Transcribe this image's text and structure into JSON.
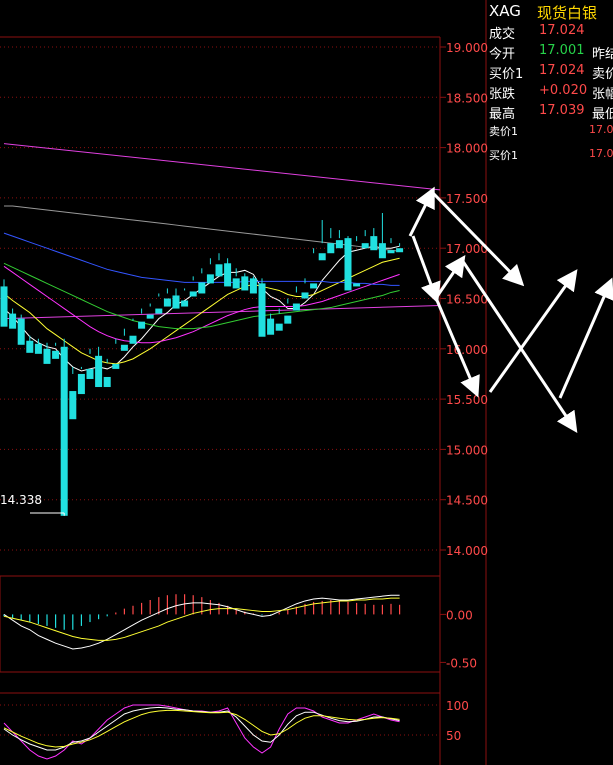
{
  "quote": {
    "symbol": "XAG",
    "name": "现货白银",
    "rows": [
      {
        "label": "成交",
        "value": "17.024",
        "color": "red",
        "label2": ""
      },
      {
        "label": "今开",
        "value": "17.001",
        "color": "green",
        "label2": "昨结"
      },
      {
        "label": "买价1",
        "value": "17.024",
        "color": "red",
        "label2": "卖价"
      },
      {
        "label": "张跌",
        "value": "+0.020",
        "color": "red",
        "label2": "张幅"
      },
      {
        "label": "最高",
        "value": "17.039",
        "color": "red",
        "label2": "最低"
      }
    ],
    "ask_label": "卖价1",
    "ask_value": "17.0",
    "bid_label": "买价1",
    "bid_value": "17.0"
  },
  "colors": {
    "up": "#ff4a4a",
    "down": "#21e0e0",
    "ma5": "#ffffff",
    "ma10": "#ffff33",
    "ma20": "#ff33ff",
    "ma30": "#33cc33",
    "ma60": "#3355ff",
    "ma120": "#999999",
    "trendline": "#e040e0",
    "grid": "#8b1010",
    "arrows": "#ffffff"
  },
  "chart_data": [
    {
      "type": "candlestick",
      "title": "",
      "y_ticks": [
        "19.000",
        "18.500",
        "18.000",
        "17.500",
        "17.000",
        "16.500",
        "16.000",
        "15.500",
        "15.000",
        "14.500",
        "14.000"
      ],
      "ylim": [
        14.0,
        19.0
      ],
      "min_label": "14.338",
      "candles": [
        [
          16.62,
          16.69,
          16.26,
          16.22
        ],
        [
          16.35,
          16.4,
          16.3,
          16.2
        ],
        [
          16.3,
          16.34,
          16.06,
          16.04
        ],
        [
          16.08,
          16.13,
          16.02,
          15.96
        ],
        [
          16.05,
          16.1,
          16.0,
          15.95
        ],
        [
          16.0,
          16.06,
          15.9,
          15.85
        ],
        [
          15.98,
          16.03,
          16.06,
          15.9
        ],
        [
          16.02,
          16.1,
          15.58,
          14.34
        ],
        [
          15.58,
          15.82,
          15.75,
          15.3
        ],
        [
          15.75,
          15.8,
          15.82,
          15.55
        ],
        [
          15.8,
          16.0,
          15.95,
          15.7
        ],
        [
          15.93,
          16.02,
          15.72,
          15.62
        ],
        [
          15.72,
          15.9,
          15.86,
          15.62
        ],
        [
          15.85,
          16.1,
          16.05,
          15.8
        ],
        [
          16.04,
          16.2,
          16.13,
          15.98
        ],
        [
          16.13,
          16.3,
          16.28,
          16.05
        ],
        [
          16.27,
          16.4,
          16.35,
          16.2
        ],
        [
          16.34,
          16.45,
          16.42,
          16.3
        ],
        [
          16.4,
          16.55,
          16.52,
          16.35
        ],
        [
          16.5,
          16.6,
          16.55,
          16.42
        ],
        [
          16.53,
          16.6,
          16.48,
          16.4
        ],
        [
          16.48,
          16.6,
          16.58,
          16.42
        ],
        [
          16.57,
          16.72,
          16.68,
          16.52
        ],
        [
          16.66,
          16.8,
          16.75,
          16.55
        ],
        [
          16.74,
          16.9,
          16.84,
          16.65
        ],
        [
          16.84,
          16.95,
          16.88,
          16.72
        ],
        [
          16.85,
          16.9,
          16.7,
          16.62
        ],
        [
          16.7,
          16.8,
          16.72,
          16.6
        ],
        [
          16.72,
          16.75,
          16.7,
          16.58
        ],
        [
          16.7,
          16.72,
          16.62,
          16.55
        ],
        [
          16.65,
          16.7,
          16.3,
          16.12
        ],
        [
          16.3,
          16.35,
          16.24,
          16.14
        ],
        [
          16.25,
          16.4,
          16.35,
          16.18
        ],
        [
          16.33,
          16.5,
          16.45,
          16.25
        ],
        [
          16.45,
          16.62,
          16.56,
          16.38
        ],
        [
          16.56,
          16.7,
          16.65,
          16.5
        ],
        [
          16.65,
          17.0,
          16.95,
          16.6
        ],
        [
          16.95,
          17.28,
          17.05,
          16.88
        ],
        [
          17.05,
          17.2,
          17.1,
          16.95
        ],
        [
          17.08,
          17.18,
          17.1,
          17.0
        ],
        [
          17.1,
          17.12,
          16.63,
          16.58
        ],
        [
          16.65,
          17.12,
          17.07,
          16.62
        ],
        [
          17.05,
          17.18,
          17.12,
          17.0
        ],
        [
          17.12,
          17.2,
          17.05,
          16.98
        ],
        [
          17.05,
          17.35,
          16.95,
          16.9
        ],
        [
          16.98,
          17.1,
          17.05,
          16.95
        ],
        [
          17.0,
          17.05,
          17.02,
          16.96
        ]
      ],
      "ma_lines": [
        {
          "name": "MA5",
          "values": [
            16.4,
            16.32,
            16.22,
            16.12,
            16.06,
            16.02,
            16.0,
            15.9,
            15.82,
            15.78,
            15.8,
            15.82,
            15.8,
            15.84,
            15.92,
            16.02,
            16.1,
            16.2,
            16.3,
            16.36,
            16.44,
            16.48,
            16.54,
            16.6,
            16.66,
            16.72,
            16.76,
            16.76,
            16.78,
            16.74,
            16.6,
            16.52,
            16.48,
            16.4,
            16.4,
            16.46,
            16.54,
            16.68,
            16.78,
            16.88,
            16.96,
            16.98,
            17.0,
            17.02,
            17.0,
            17.0,
            17.02
          ]
        },
        {
          "name": "MA10",
          "values": [
            16.55,
            16.48,
            16.42,
            16.36,
            16.28,
            16.2,
            16.14,
            16.08,
            16.02,
            15.96,
            15.92,
            15.88,
            15.86,
            15.85,
            15.87,
            15.9,
            15.95,
            16.0,
            16.06,
            16.12,
            16.18,
            16.24,
            16.3,
            16.36,
            16.42,
            16.48,
            16.54,
            16.58,
            16.62,
            16.64,
            16.62,
            16.6,
            16.58,
            16.54,
            16.52,
            16.52,
            16.54,
            16.58,
            16.62,
            16.66,
            16.7,
            16.74,
            16.78,
            16.82,
            16.86,
            16.88,
            16.9
          ]
        },
        {
          "name": "MA20",
          "values": [
            16.82,
            16.76,
            16.7,
            16.64,
            16.58,
            16.52,
            16.46,
            16.4,
            16.34,
            16.28,
            16.22,
            16.17,
            16.13,
            16.1,
            16.08,
            16.07,
            16.06,
            16.06,
            16.07,
            16.09,
            16.11,
            16.14,
            16.17,
            16.21,
            16.25,
            16.29,
            16.33,
            16.36,
            16.39,
            16.41,
            16.42,
            16.42,
            16.42,
            16.42,
            16.42,
            16.43,
            16.45,
            16.47,
            16.5,
            16.53,
            16.56,
            16.59,
            16.62,
            16.65,
            16.68,
            16.71,
            16.74
          ]
        },
        {
          "name": "MA30",
          "values": [
            16.85,
            16.81,
            16.77,
            16.73,
            16.69,
            16.65,
            16.61,
            16.57,
            16.53,
            16.49,
            16.45,
            16.41,
            16.37,
            16.34,
            16.31,
            16.28,
            16.26,
            16.24,
            16.22,
            16.21,
            16.2,
            16.2,
            16.2,
            16.21,
            16.22,
            16.24,
            16.26,
            16.28,
            16.3,
            16.32,
            16.33,
            16.34,
            16.35,
            16.36,
            16.37,
            16.38,
            16.39,
            16.4,
            16.41,
            16.43,
            16.45,
            16.47,
            16.49,
            16.51,
            16.53,
            16.56,
            16.58
          ]
        },
        {
          "name": "MA60",
          "values": [
            17.15,
            17.12,
            17.09,
            17.06,
            17.03,
            17.0,
            16.97,
            16.94,
            16.91,
            16.88,
            16.85,
            16.82,
            16.79,
            16.77,
            16.75,
            16.73,
            16.71,
            16.7,
            16.69,
            16.68,
            16.67,
            16.66,
            16.66,
            16.66,
            16.66,
            16.66,
            16.66,
            16.66,
            16.67,
            16.67,
            16.67,
            16.67,
            16.67,
            16.67,
            16.67,
            16.67,
            16.67,
            16.67,
            16.66,
            16.66,
            16.66,
            16.65,
            16.65,
            16.64,
            16.64,
            16.63,
            16.63
          ]
        },
        {
          "name": "MA120",
          "values": [
            17.42,
            17.42,
            17.41,
            17.4,
            17.39,
            17.38,
            17.37,
            17.36,
            17.35,
            17.34,
            17.33,
            17.32,
            17.31,
            17.3,
            17.29,
            17.28,
            17.27,
            17.26,
            17.25,
            17.24,
            17.23,
            17.22,
            17.21,
            17.2,
            17.19,
            17.18,
            17.17,
            17.16,
            17.15,
            17.14,
            17.13,
            17.12,
            17.11,
            17.1,
            17.09,
            17.08,
            17.07,
            17.06,
            17.05,
            17.04,
            17.03,
            17.02,
            17.01,
            17.0,
            16.99,
            16.98,
            16.97
          ]
        }
      ],
      "trendlines": [
        {
          "from": [
            0,
            18.04
          ],
          "to": [
            53,
            17.58
          ]
        },
        {
          "from": [
            0,
            16.3
          ],
          "to": [
            53,
            16.43
          ]
        }
      ],
      "projection_arrows": 6
    },
    {
      "type": "bar",
      "title": "",
      "y_ticks": [
        "0.00",
        "-0.50"
      ],
      "ylim": [
        -0.6,
        0.4
      ],
      "values": [
        -0.02,
        -0.04,
        -0.06,
        -0.08,
        -0.1,
        -0.12,
        -0.14,
        -0.16,
        -0.16,
        -0.12,
        -0.08,
        -0.05,
        -0.02,
        0.02,
        0.06,
        0.09,
        0.12,
        0.15,
        0.18,
        0.2,
        0.21,
        0.21,
        0.2,
        0.18,
        0.15,
        0.12,
        0.09,
        0.05,
        0.03,
        0.01,
        -0.01,
        -0.01,
        0.02,
        0.05,
        0.08,
        0.11,
        0.13,
        0.14,
        0.15,
        0.14,
        0.13,
        0.12,
        0.11,
        0.1,
        0.1,
        0.11,
        0.1
      ],
      "dif": [
        0.0,
        -0.06,
        -0.12,
        -0.16,
        -0.22,
        -0.26,
        -0.3,
        -0.33,
        -0.36,
        -0.35,
        -0.33,
        -0.3,
        -0.26,
        -0.21,
        -0.16,
        -0.11,
        -0.06,
        -0.02,
        0.02,
        0.06,
        0.09,
        0.11,
        0.12,
        0.12,
        0.11,
        0.1,
        0.08,
        0.05,
        0.02,
        0.0,
        -0.02,
        -0.01,
        0.03,
        0.07,
        0.11,
        0.14,
        0.16,
        0.17,
        0.16,
        0.15,
        0.15,
        0.16,
        0.17,
        0.18,
        0.19,
        0.2,
        0.2
      ],
      "dea": [
        -0.02,
        -0.04,
        -0.06,
        -0.08,
        -0.11,
        -0.14,
        -0.17,
        -0.2,
        -0.23,
        -0.25,
        -0.26,
        -0.27,
        -0.27,
        -0.26,
        -0.24,
        -0.21,
        -0.18,
        -0.15,
        -0.12,
        -0.08,
        -0.05,
        -0.02,
        0.01,
        0.03,
        0.05,
        0.06,
        0.06,
        0.06,
        0.05,
        0.04,
        0.03,
        0.03,
        0.04,
        0.05,
        0.07,
        0.09,
        0.11,
        0.12,
        0.13,
        0.14,
        0.14,
        0.15,
        0.15,
        0.16,
        0.16,
        0.17,
        0.17
      ]
    },
    {
      "type": "line",
      "title": "",
      "y_ticks": [
        "100",
        "50"
      ],
      "ylim": [
        0,
        120
      ],
      "series": [
        {
          "color": "#ff33ff",
          "values": [
            70,
            55,
            40,
            25,
            15,
            10,
            15,
            25,
            40,
            35,
            45,
            60,
            75,
            85,
            95,
            100,
            100,
            100,
            100,
            98,
            95,
            92,
            90,
            90,
            88,
            90,
            95,
            70,
            45,
            30,
            20,
            30,
            60,
            85,
            95,
            95,
            90,
            80,
            75,
            70,
            70,
            75,
            80,
            85,
            80,
            75,
            72
          ]
        },
        {
          "color": "#ffffff",
          "values": [
            60,
            50,
            42,
            35,
            30,
            25,
            25,
            30,
            38,
            40,
            45,
            55,
            65,
            75,
            85,
            90,
            93,
            95,
            96,
            95,
            93,
            92,
            90,
            89,
            88,
            88,
            90,
            80,
            65,
            50,
            40,
            38,
            50,
            68,
            82,
            88,
            88,
            83,
            78,
            74,
            72,
            73,
            76,
            80,
            80,
            77,
            74
          ]
        },
        {
          "color": "#ffff33",
          "values": [
            62,
            55,
            48,
            42,
            36,
            32,
            30,
            31,
            35,
            38,
            42,
            48,
            56,
            64,
            72,
            78,
            84,
            88,
            90,
            91,
            91,
            90,
            89,
            88,
            87,
            87,
            88,
            84,
            76,
            66,
            56,
            50,
            52,
            60,
            70,
            78,
            82,
            82,
            80,
            78,
            76,
            75,
            76,
            78,
            79,
            78,
            76
          ]
        }
      ]
    }
  ]
}
